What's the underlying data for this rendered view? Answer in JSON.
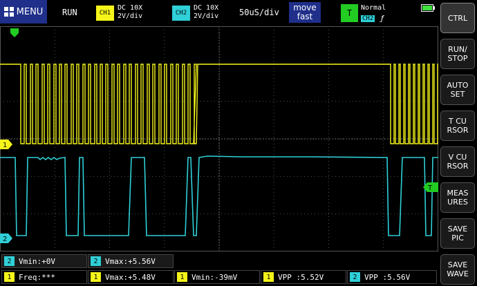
{
  "topbar": {
    "menu_label": "MENU",
    "run_status": "RUN",
    "ch1": {
      "badge": "CH1",
      "coupling": "DC 10X",
      "scale": "2V/div",
      "color": "#f5f51a"
    },
    "ch2": {
      "badge": "CH2",
      "coupling": "DC 10X",
      "scale": "2V/div",
      "color": "#2fd0d8"
    },
    "timebase": "50uS/div",
    "move_line1": "move",
    "move_line2": "fast",
    "trigger": {
      "badge": "T",
      "mode": "Normal",
      "source": "CH2",
      "edge": "ƒ"
    },
    "battery_icon": "battery-icon"
  },
  "sidebar": {
    "buttons": [
      {
        "label": "CTRL"
      },
      {
        "label": "RUN/\nSTOP"
      },
      {
        "label": "AUTO\nSET"
      },
      {
        "label": "T CU\nRSOR"
      },
      {
        "label": "V CU\nRSOR"
      },
      {
        "label": "MEAS\nURES"
      },
      {
        "label": "SAVE\nPIC"
      },
      {
        "label": "SAVE\nWAVE"
      }
    ]
  },
  "markers": {
    "ch1": "1",
    "ch2": "2",
    "trigger": "T"
  },
  "measurements": {
    "row1": [
      {
        "ch": "2",
        "text": "Vmin:+0V"
      },
      {
        "ch": "2",
        "text": "Vmax:+5.56V"
      }
    ],
    "row2": [
      {
        "ch": "1",
        "text": "Freq:***"
      },
      {
        "ch": "1",
        "text": "Vmax:+5.48V"
      },
      {
        "ch": "1",
        "text": "Vmin:-39mV"
      },
      {
        "ch": "1",
        "text": "VPP :5.52V"
      },
      {
        "ch": "2",
        "text": "VPP :5.56V"
      }
    ]
  },
  "colors": {
    "ch1": "#f5f51a",
    "ch2": "#2fd0d8",
    "grid": "#555555",
    "trigger": "#22cc22"
  }
}
